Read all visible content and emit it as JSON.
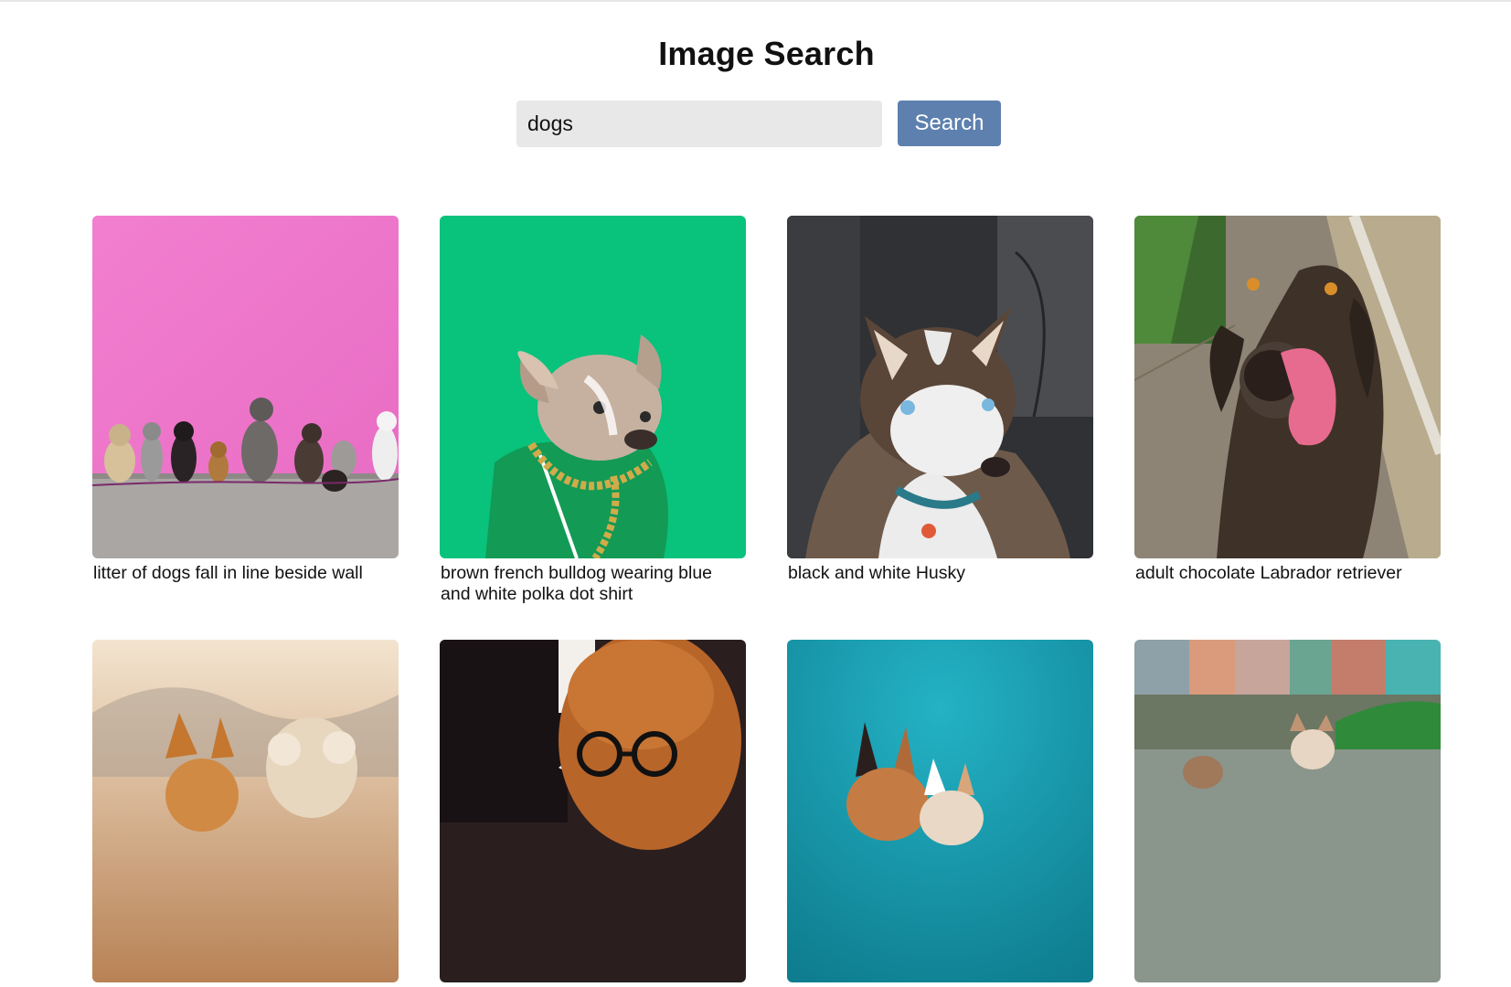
{
  "header": {
    "title": "Image Search"
  },
  "search": {
    "value": "dogs",
    "button_label": "Search"
  },
  "results": [
    {
      "caption": "litter of dogs fall in line beside wall",
      "bg": "#ef77cc"
    },
    {
      "caption": "brown french bulldog wearing blue and white polka dot shirt",
      "bg": "#09c27c"
    },
    {
      "caption": "black and white Husky",
      "bg": "#3a3a3c"
    },
    {
      "caption": "adult chocolate Labrador retriever",
      "bg": "#7d6b52"
    },
    {
      "caption": "",
      "bg": "#c08b5a"
    },
    {
      "caption": "",
      "bg": "#5a3a2a"
    },
    {
      "caption": "",
      "bg": "#1aa6b8"
    },
    {
      "caption": "",
      "bg": "#8aa08e"
    }
  ]
}
